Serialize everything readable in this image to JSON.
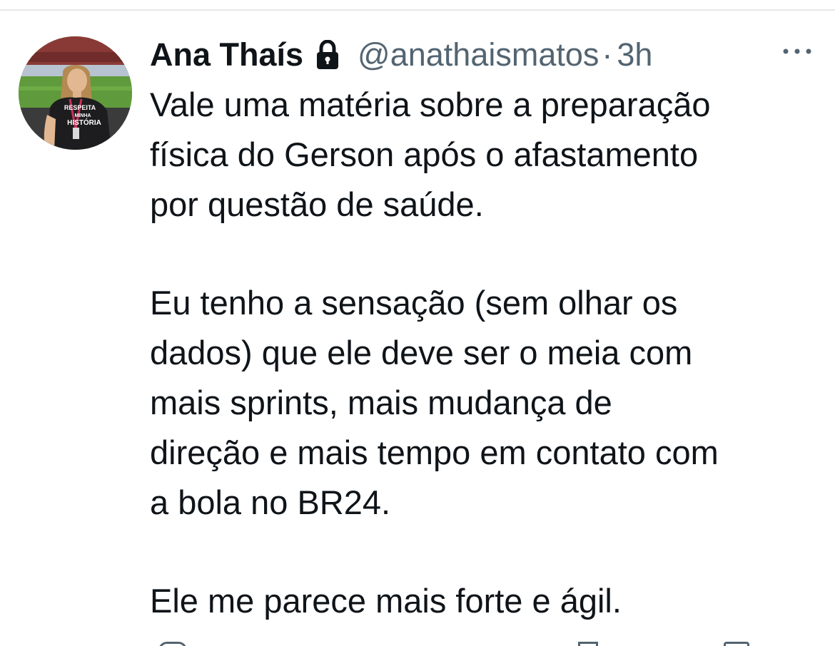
{
  "tweet": {
    "author": {
      "display_name": "Ana Thaís",
      "handle": "@anathaismatos",
      "protected_icon": "lock-icon",
      "avatar_shirt_text": [
        "RESPEITA",
        "MINHA",
        "HISTÓRIA"
      ]
    },
    "separator": "·",
    "timestamp": "3h",
    "more_icon": "more-horizontal-icon",
    "body": [
      {
        "lines": [
          "Vale uma matéria sobre a preparação",
          "física do Gerson após o afastamento",
          "por questão de saúde."
        ]
      },
      {
        "lines": [
          "Eu tenho a sensação (sem olhar os",
          "dados) que ele deve ser o meia com",
          "mais sprints, mais mudança de",
          "direção e mais tempo em contato com",
          "a bola no BR24."
        ]
      },
      {
        "lines": [
          "Ele me parece mais forte e ágil."
        ]
      }
    ],
    "colors": {
      "text_primary": "#0f1419",
      "text_secondary": "#536471",
      "divider": "#e7e7e7"
    }
  }
}
